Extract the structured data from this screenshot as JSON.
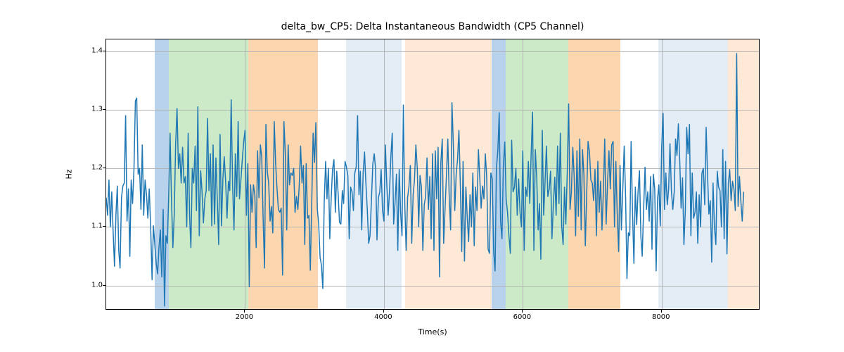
{
  "chart_data": {
    "type": "line",
    "title": "delta_bw_CP5: Delta Instantaneous Bandwidth (CP5 Channel)",
    "xlabel": "Time(s)",
    "ylabel": "Hz",
    "xlim": [
      0,
      9400
    ],
    "ylim": [
      0.96,
      1.42
    ],
    "xticks": [
      2000,
      4000,
      6000,
      8000
    ],
    "yticks": [
      1.0,
      1.1,
      1.2,
      1.3,
      1.4
    ],
    "bands": [
      {
        "x0": 700,
        "x1": 900,
        "color": "#a7c7e7",
        "alpha": 0.8
      },
      {
        "x0": 900,
        "x1": 2050,
        "color": "#b7e1b1",
        "alpha": 0.7
      },
      {
        "x0": 2050,
        "x1": 3050,
        "color": "#f9c893",
        "alpha": 0.75
      },
      {
        "x0": 3450,
        "x1": 4250,
        "color": "#d9e6f2",
        "alpha": 0.7
      },
      {
        "x0": 4300,
        "x1": 5550,
        "color": "#fce4cc",
        "alpha": 0.8
      },
      {
        "x0": 5550,
        "x1": 5750,
        "color": "#a7c7e7",
        "alpha": 0.8
      },
      {
        "x0": 5750,
        "x1": 6650,
        "color": "#b7e1b1",
        "alpha": 0.7
      },
      {
        "x0": 6650,
        "x1": 7400,
        "color": "#f9c893",
        "alpha": 0.75
      },
      {
        "x0": 7950,
        "x1": 8950,
        "color": "#d9e6f2",
        "alpha": 0.7
      },
      {
        "x0": 8950,
        "x1": 9400,
        "color": "#fce4cc",
        "alpha": 0.8
      }
    ],
    "series": [
      {
        "name": "delta_bw_CP5",
        "color": "#1f77b4",
        "x_step": 20,
        "y": [
          1.15,
          1.12,
          1.18,
          1.1,
          1.16,
          1.09,
          1.033,
          1.12,
          1.17,
          1.06,
          1.03,
          1.15,
          1.17,
          1.175,
          1.29,
          1.11,
          1.165,
          1.05,
          1.18,
          1.14,
          1.2,
          1.315,
          1.32,
          1.19,
          1.2,
          1.13,
          1.24,
          1.12,
          1.18,
          1.155,
          1.115,
          1.165,
          1.1,
          1.01,
          1.102,
          1.07,
          1.038,
          1.02,
          1.065,
          1.095,
          1.015,
          1.13,
          0.965,
          1.085,
          1.072,
          1.155,
          1.26,
          1.148,
          1.065,
          1.12,
          1.24,
          1.302,
          1.2,
          1.225,
          1.175,
          1.236,
          1.175,
          1.186,
          1.1,
          1.26,
          1.12,
          1.065,
          1.2,
          1.175,
          1.238,
          1.128,
          1.305,
          1.085,
          1.196,
          1.162,
          1.107,
          1.148,
          1.162,
          1.285,
          1.162,
          1.225,
          1.102,
          1.24,
          1.105,
          1.218,
          1.145,
          1.07,
          1.258,
          1.102,
          1.182,
          1.22,
          1.178,
          1.115,
          1.178,
          1.162,
          1.317,
          1.172,
          1.095,
          1.225,
          1.152,
          1.28,
          1.148,
          1.18,
          1.215,
          1.245,
          1.265,
          1.12,
          1.208,
          0.998,
          1.172,
          1.125,
          1.172,
          1.155,
          1.065,
          1.23,
          1.15,
          1.24,
          1.22,
          1.115,
          1.03,
          1.275,
          1.195,
          1.175,
          1.11,
          1.135,
          1.09,
          1.28,
          1.208,
          1.165,
          1.13,
          1.125,
          1.132,
          1.018,
          1.28,
          1.225,
          1.095,
          1.24,
          1.172,
          1.192,
          1.188,
          1.2,
          1.125,
          1.152,
          1.13,
          1.172,
          1.238,
          1.175,
          1.205,
          1.07,
          1.208,
          1.115,
          1.12,
          1.026,
          1.14,
          1.26,
          1.21,
          1.278,
          1.132,
          1.105,
          1.048,
          1.035,
          0.995,
          1.145,
          1.212,
          1.148,
          1.2,
          1.08,
          1.15,
          1.198,
          1.215,
          1.125,
          1.195,
          1.158,
          1.108,
          1.105,
          1.162,
          1.14,
          1.212,
          1.202,
          1.188,
          1.08,
          1.168,
          1.16,
          1.128,
          1.192,
          1.202,
          1.29,
          1.155,
          1.195,
          1.095,
          1.192,
          1.228,
          1.175,
          1.13,
          1.072,
          1.085,
          1.146,
          1.208,
          1.225,
          1.2,
          1.078,
          1.15,
          1.16,
          1.198,
          1.128,
          1.11,
          1.24,
          1.178,
          1.12,
          1.16,
          1.222,
          1.26,
          1.105,
          1.142,
          1.19,
          1.06,
          1.198,
          1.125,
          1.085,
          1.308,
          1.138,
          1.06,
          1.15,
          1.168,
          1.205,
          1.072,
          1.155,
          1.18,
          1.24,
          1.2,
          1.1,
          1.188,
          1.168,
          1.06,
          1.138,
          1.152,
          1.218,
          1.13,
          1.186,
          1.08,
          1.225,
          1.06,
          1.23,
          1.148,
          1.236,
          1.015,
          1.21,
          1.25,
          1.072,
          1.132,
          1.186,
          1.25,
          1.152,
          1.095,
          1.312,
          1.238,
          1.128,
          1.19,
          1.215,
          1.265,
          1.172,
          1.058,
          1.212,
          1.042,
          1.168,
          1.115,
          1.075,
          1.155,
          1.1,
          1.192,
          1.068,
          1.168,
          1.128,
          1.232,
          1.185,
          1.132,
          1.17,
          1.148,
          1.225,
          1.186,
          1.062,
          1.055,
          1.192,
          1.182,
          1.058,
          1.025,
          1.2,
          1.23,
          1.295,
          1.11,
          1.08,
          1.205,
          1.245,
          1.148,
          1.125,
          1.085,
          1.055,
          1.248,
          1.16,
          1.168,
          1.2,
          1.12,
          1.182,
          1.125,
          1.1,
          1.23,
          1.06,
          1.168,
          1.152,
          1.212,
          1.14,
          1.225,
          1.296,
          1.06,
          1.232,
          1.185,
          1.095,
          1.14,
          1.045,
          1.265,
          1.12,
          1.175,
          1.238,
          1.152,
          1.165,
          1.195,
          1.08,
          1.14,
          1.185,
          1.12,
          1.238,
          1.14,
          1.26,
          1.102,
          1.07,
          1.168,
          1.105,
          1.192,
          1.31,
          1.13,
          1.16,
          1.236,
          1.185,
          1.085,
          1.23,
          1.118,
          1.25,
          1.095,
          1.232,
          1.19,
          1.068,
          1.158,
          1.246,
          1.228,
          1.18,
          1.175,
          1.145,
          1.198,
          1.085,
          1.212,
          1.125,
          1.178,
          1.095,
          1.162,
          1.25,
          1.105,
          1.175,
          1.23,
          1.165,
          1.24,
          1.246,
          1.1,
          1.212,
          1.122,
          1.058,
          1.205,
          1.095,
          1.165,
          1.238,
          1.15,
          1.012,
          1.09,
          1.085,
          1.246,
          1.125,
          1.038,
          1.168,
          1.104,
          1.16,
          1.196,
          1.084,
          1.05,
          1.13,
          1.202,
          1.13,
          1.16,
          1.11,
          1.186,
          1.062,
          1.19,
          1.165,
          1.025,
          1.148,
          1.172,
          1.102,
          1.236,
          1.294,
          1.13,
          1.192,
          1.138,
          1.165,
          1.242,
          1.162,
          1.13,
          1.16,
          1.25,
          1.222,
          1.276,
          1.212,
          1.132,
          1.184,
          1.07,
          1.128,
          1.27,
          1.225,
          1.275,
          1.085,
          1.192,
          1.115,
          1.125,
          1.16,
          1.072,
          1.155,
          1.1,
          1.192,
          1.2,
          1.138,
          1.27,
          1.192,
          1.122,
          1.145,
          1.04,
          1.175,
          1.1,
          1.07,
          1.195,
          1.168,
          1.162,
          1.1,
          1.232,
          1.08,
          1.212,
          1.054,
          1.175,
          1.198,
          1.145,
          1.178,
          1.165,
          1.128,
          1.396,
          1.135,
          1.186,
          1.145,
          1.11,
          1.16
        ]
      }
    ]
  }
}
